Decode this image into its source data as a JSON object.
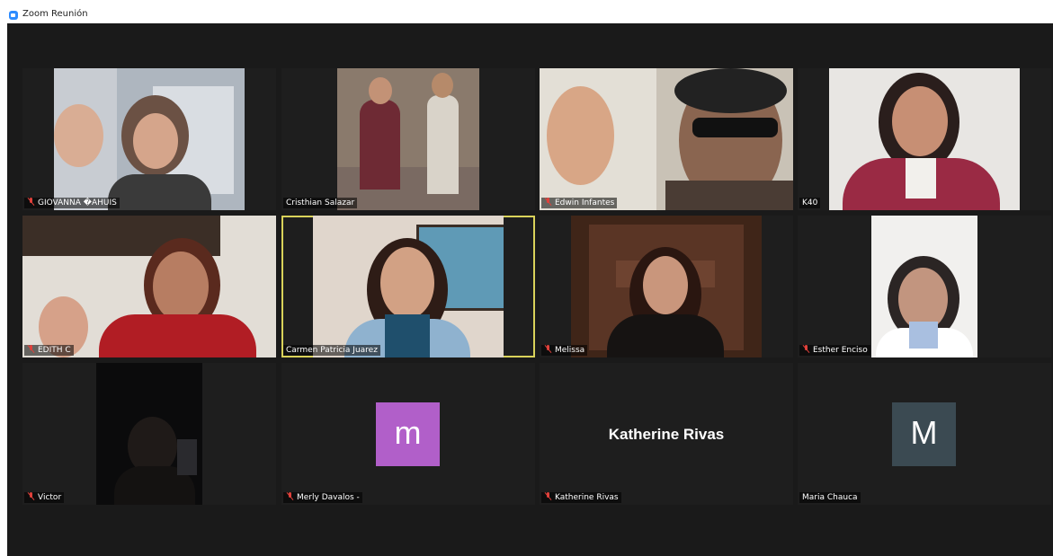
{
  "window": {
    "title": "Zoom Reunión"
  },
  "participants": [
    {
      "name": "GIOVANNA �AHUIS",
      "muted": true
    },
    {
      "name": "Cristhian Salazar",
      "muted": false
    },
    {
      "name": "Edwin Infantes",
      "muted": true
    },
    {
      "name": "K40",
      "muted": false
    },
    {
      "name": "EDITH C",
      "muted": true
    },
    {
      "name": "Carmen Patricia Juarez",
      "muted": false,
      "active_speaker": true
    },
    {
      "name": "Melissa",
      "muted": true
    },
    {
      "name": "Esther Enciso",
      "muted": true
    },
    {
      "name": "Victor",
      "muted": true
    },
    {
      "name": "Merly Davalos -",
      "muted": true,
      "avatar_letter": "m",
      "avatar_color": "#b15fc9"
    },
    {
      "name": "Katherine Rivas",
      "muted": true,
      "display_text": "Katherine Rivas"
    },
    {
      "name": "Maria Chauca",
      "muted": false,
      "avatar_letter": "M",
      "avatar_color": "#3b4a52"
    }
  ],
  "colors": {
    "active_speaker_border": "#d9d25a",
    "muted_icon": "#e0413b",
    "background": "#1a1a1a"
  }
}
